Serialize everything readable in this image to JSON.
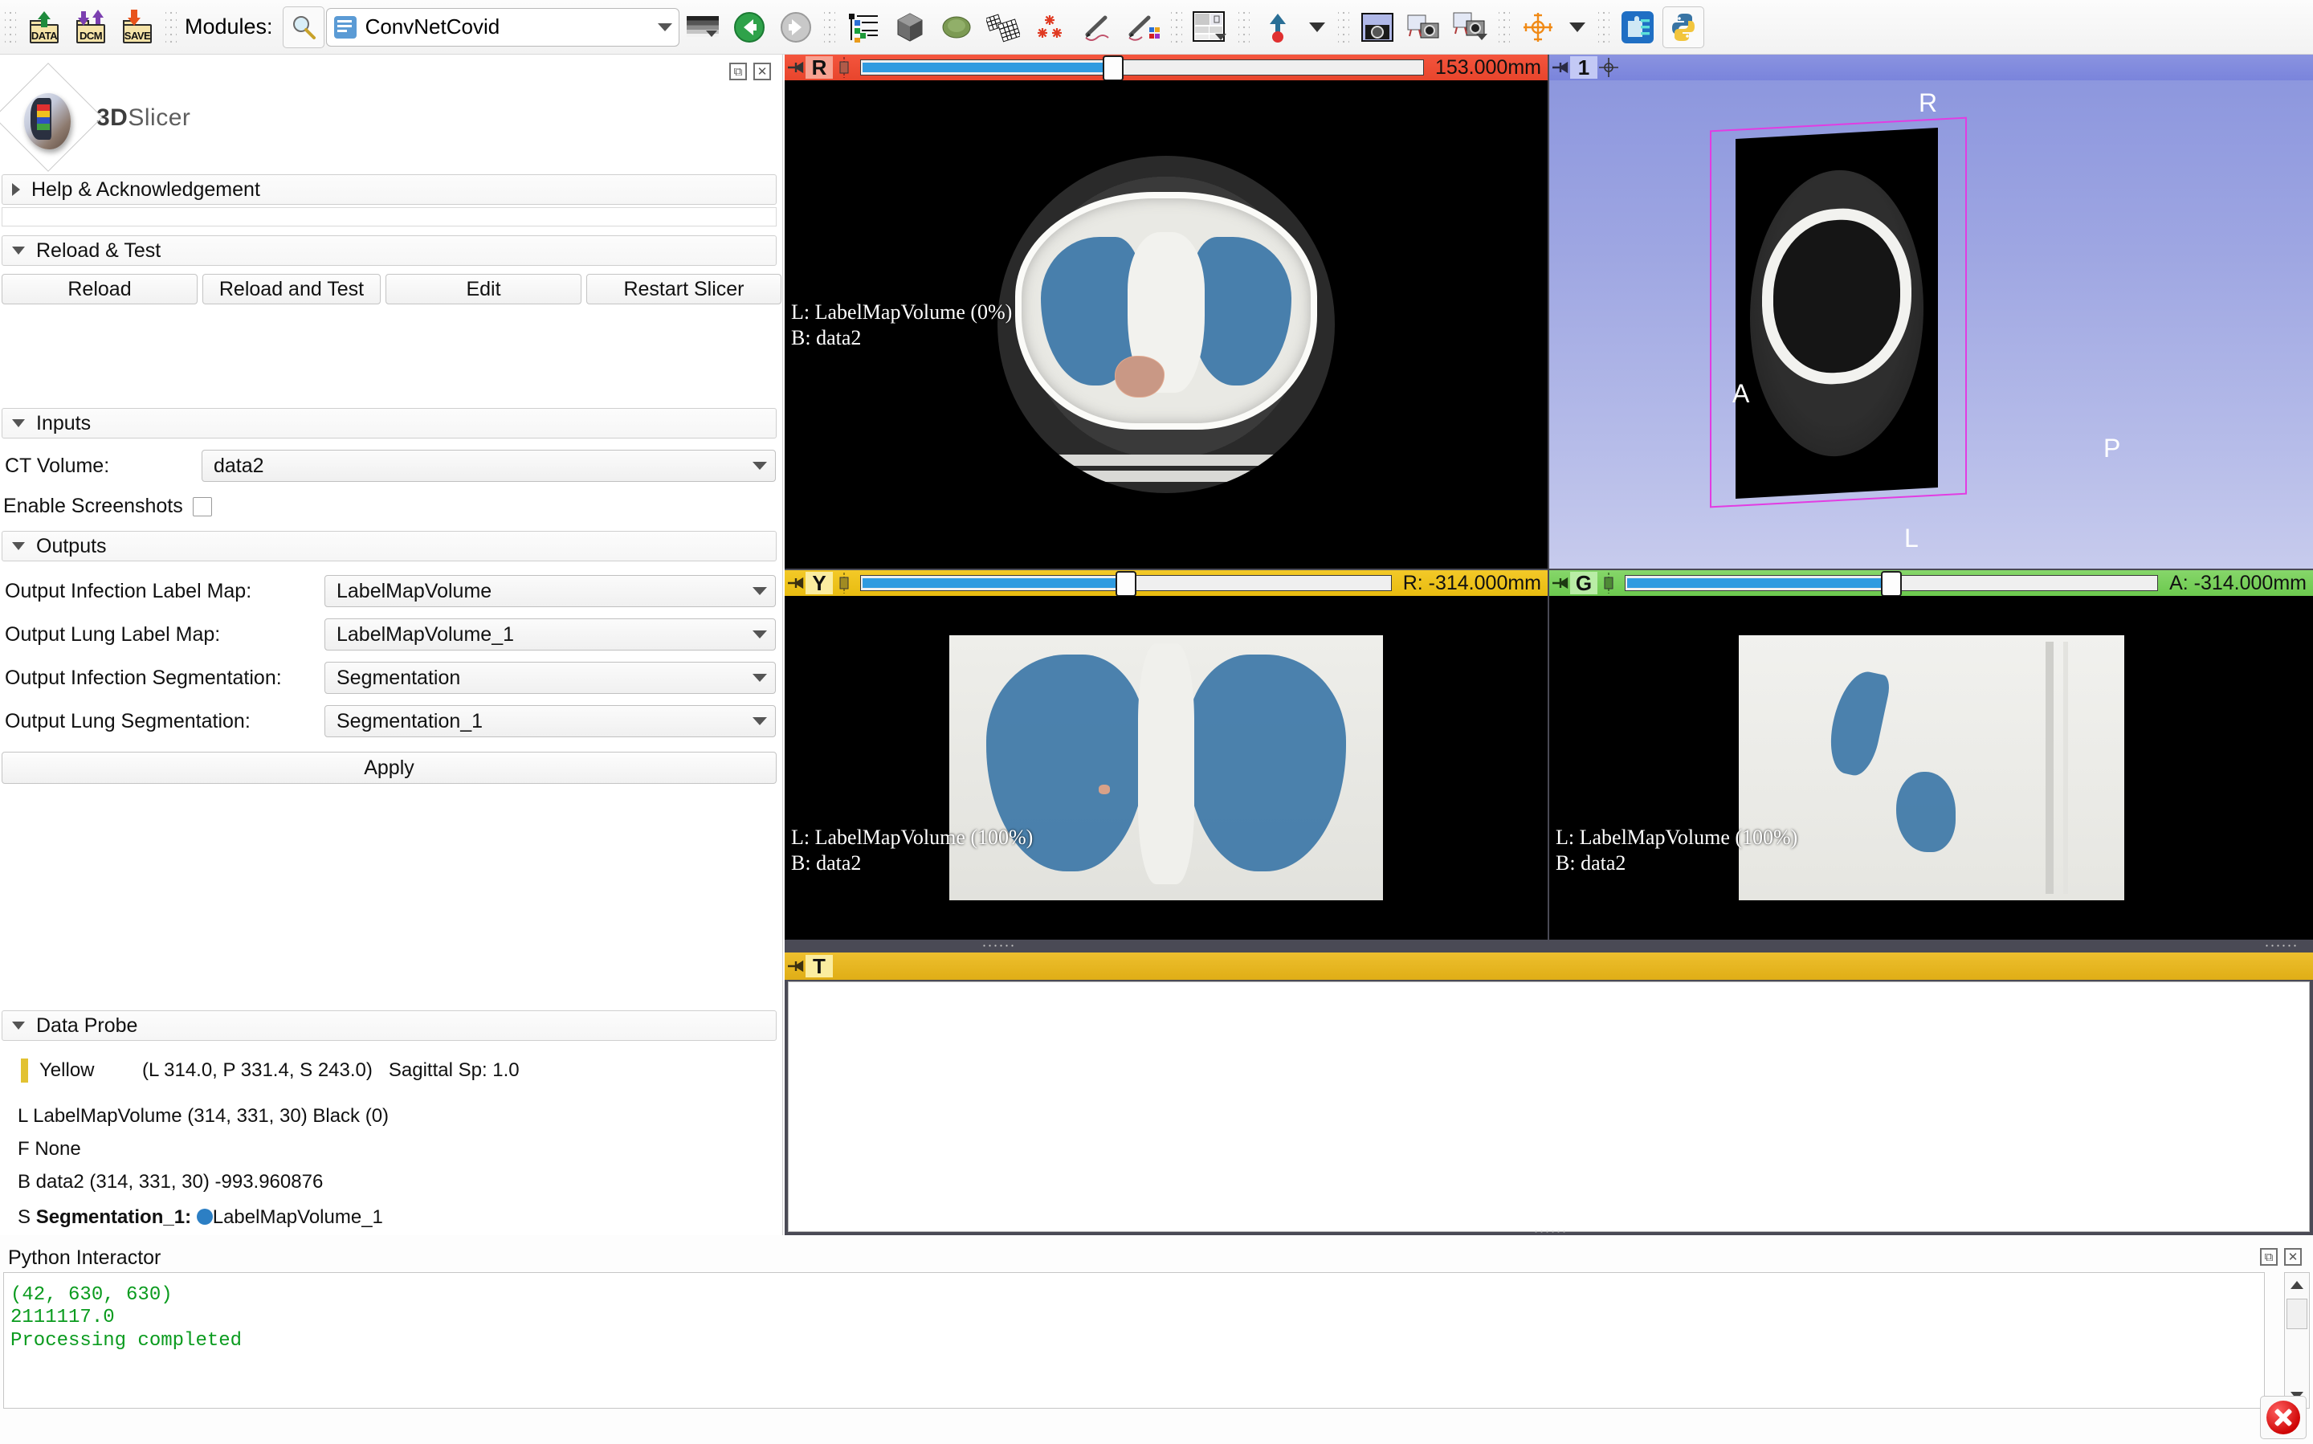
{
  "toolbar": {
    "file_buttons": [
      {
        "label": "DATA",
        "name": "load-data-button"
      },
      {
        "label": "DCM",
        "name": "load-dicom-button"
      },
      {
        "label": "SAVE",
        "name": "save-data-button"
      }
    ],
    "modules_label": "Modules:",
    "module_search_icon": "magnifier-icon",
    "module_selected": "ConvNetCovid",
    "icons": [
      "colormap-icon",
      "history-back-icon",
      "history-forward-icon",
      "subject-hierarchy-icon",
      "volume-rendering-icon",
      "models-icon",
      "transform-icon",
      "markups-icon",
      "annotations-icon",
      "segment-editor-icon",
      "layout-icon",
      "center-view-icon",
      "screenshot-icon",
      "scene-views-icon",
      "capture-icon",
      "crosshair-icon",
      "extensions-icon",
      "python-console-icon"
    ]
  },
  "left_panel": {
    "logo_text_1": "3D",
    "logo_text_2": "Slicer",
    "dock_buttons": [
      "float-icon",
      "close-icon"
    ],
    "sections": {
      "help": {
        "title": "Help & Acknowledgement",
        "expanded": false
      },
      "reload": {
        "title": "Reload & Test",
        "expanded": true
      },
      "inputs": {
        "title": "Inputs",
        "expanded": true
      },
      "outputs": {
        "title": "Outputs",
        "expanded": true
      },
      "data_probe": {
        "title": "Data Probe",
        "expanded": true
      }
    },
    "reload_buttons": [
      "Reload",
      "Reload and Test",
      "Edit",
      "Restart Slicer"
    ],
    "inputs": {
      "ct_volume_label": "CT Volume:",
      "ct_volume_value": "data2",
      "enable_screenshots_label": "Enable Screenshots",
      "enable_screenshots_checked": false
    },
    "outputs": {
      "rows": [
        {
          "label": "Output Infection Label Map:",
          "value": "LabelMapVolume"
        },
        {
          "label": "Output Lung Label Map:",
          "value": "LabelMapVolume_1"
        },
        {
          "label": "Output Infection Segmentation:",
          "value": "Segmentation"
        },
        {
          "label": "Output Lung Segmentation:",
          "value": "Segmentation_1"
        }
      ],
      "apply_label": "Apply"
    },
    "data_probe": {
      "slice_color_name": "Yellow",
      "slice_color_hex": "#e2c232",
      "coords": "(L 314.0, P 331.4, S 243.0)",
      "spacing": "Sagittal Sp: 1.0",
      "line_L": "L LabelMapVolume (314, 331,  30) Black (0)",
      "line_F": "F None",
      "line_B": "B data2                (314, 331,  30) -993.960876",
      "line_S_prefix": "S ",
      "line_S_bold": "Segmentation_1:",
      "line_S_suffix": "LabelMapVolume_1",
      "segment_color_hex": "#2c7fc4"
    }
  },
  "python_interactor": {
    "title": "Python Interactor",
    "dock_buttons": [
      "float-icon",
      "close-icon"
    ],
    "output_lines": [
      "(42, 630, 630)",
      "2111117.0",
      "Processing completed"
    ],
    "text_color_hex": "#0a9b1e",
    "close_button_name": "close-window-button"
  },
  "views": {
    "red": {
      "label": "R",
      "slider_value": "153.000mm",
      "slider_percent": 45,
      "overlay_line1": "L: LabelMapVolume (0%)",
      "overlay_line2": "B: data2",
      "header_color_hex": "#e8452c"
    },
    "yellow": {
      "label": "Y",
      "slider_value": "R: -314.000mm",
      "slider_percent": 50,
      "overlay_line1": "L: LabelMapVolume (100%)",
      "overlay_line2": "B: data2",
      "header_color_hex": "#e8bc10"
    },
    "green": {
      "label": "G",
      "slider_value": "A: -314.000mm",
      "slider_percent": 50,
      "overlay_line1": "L: LabelMapVolume (100%)",
      "overlay_line2": "B: data2",
      "header_color_hex": "#6cc94e"
    },
    "threed": {
      "label": "1",
      "header_color_hex": "#7a84dc",
      "orientation_labels": {
        "top": "R",
        "left": "A",
        "right": "P",
        "bottom": "L"
      },
      "bounding_box_color_hex": "#e23ce2"
    },
    "tan": {
      "label": "T",
      "header_color_hex": "#e0ae16"
    }
  },
  "palette": {
    "lung_segment_hex": "#3e78a8",
    "infection_segment_hex": "#c99885"
  }
}
